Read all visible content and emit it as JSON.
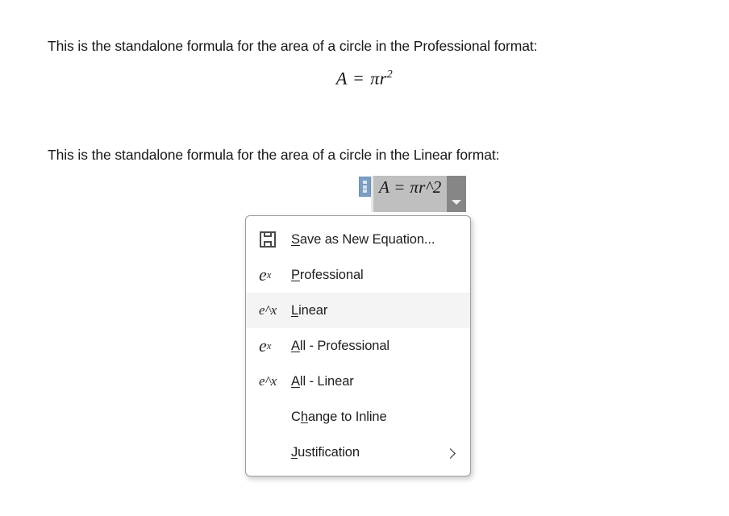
{
  "document": {
    "paragraph_1": "This is the standalone formula for the area of a circle in the Professional format:",
    "paragraph_2": "This is the standalone formula for the area of a circle in the Linear format:",
    "professional_equation": {
      "variable": "A",
      "operator": "=",
      "pi_r": "πr",
      "exponent": "2",
      "plain_text": "A = πr²"
    }
  },
  "equation_field": {
    "name": "equation-content-control",
    "value": "A = πr^2",
    "variable": "A",
    "operator": "=",
    "expression": "πr^2",
    "selected": true,
    "handle_icon": "drag-handle-icon",
    "dropdown_icon": "chevron-down-icon",
    "selection_color": "#bfbfbf",
    "handle_color": "#7b9ec4",
    "dropdown_color": "#868686"
  },
  "context_menu": {
    "highlight_color": "#f4f4f4",
    "border_color": "#9d9d9d",
    "items": [
      {
        "label_pre": "",
        "accel": "S",
        "label_post": "ave as New Equation...",
        "full_label": "Save as New Equation...",
        "icon": "save-floppy-icon",
        "icon_text": "",
        "selected": false,
        "submenu": false
      },
      {
        "label_pre": "",
        "accel": "P",
        "label_post": "rofessional",
        "full_label": "Professional",
        "icon": "e-superscript-x-icon",
        "icon_text": "e",
        "icon_sup": "x",
        "selected": false,
        "submenu": false
      },
      {
        "label_pre": "",
        "accel": "L",
        "label_post": "inear",
        "full_label": "Linear",
        "icon": "e-caret-x-icon",
        "icon_text": "e^x",
        "selected": true,
        "submenu": false
      },
      {
        "label_pre": "",
        "accel": "A",
        "label_post": "ll - Professional",
        "full_label": "All - Professional",
        "icon": "e-superscript-x-icon",
        "icon_text": "e",
        "icon_sup": "x",
        "selected": false,
        "submenu": false
      },
      {
        "label_pre": "",
        "accel": "A",
        "label_post": "ll - Linear",
        "full_label": "All - Linear",
        "icon": "e-caret-x-icon",
        "icon_text": "e^x",
        "selected": false,
        "submenu": false
      },
      {
        "label_pre": "C",
        "accel": "h",
        "label_post": "ange to Inline",
        "full_label": "Change to Inline",
        "icon": "none",
        "icon_text": "",
        "selected": false,
        "submenu": false
      },
      {
        "label_pre": "",
        "accel": "J",
        "label_post": "ustification",
        "full_label": "Justification",
        "icon": "none",
        "icon_text": "",
        "selected": false,
        "submenu": true,
        "submenu_icon": "chevron-right-icon"
      }
    ]
  }
}
